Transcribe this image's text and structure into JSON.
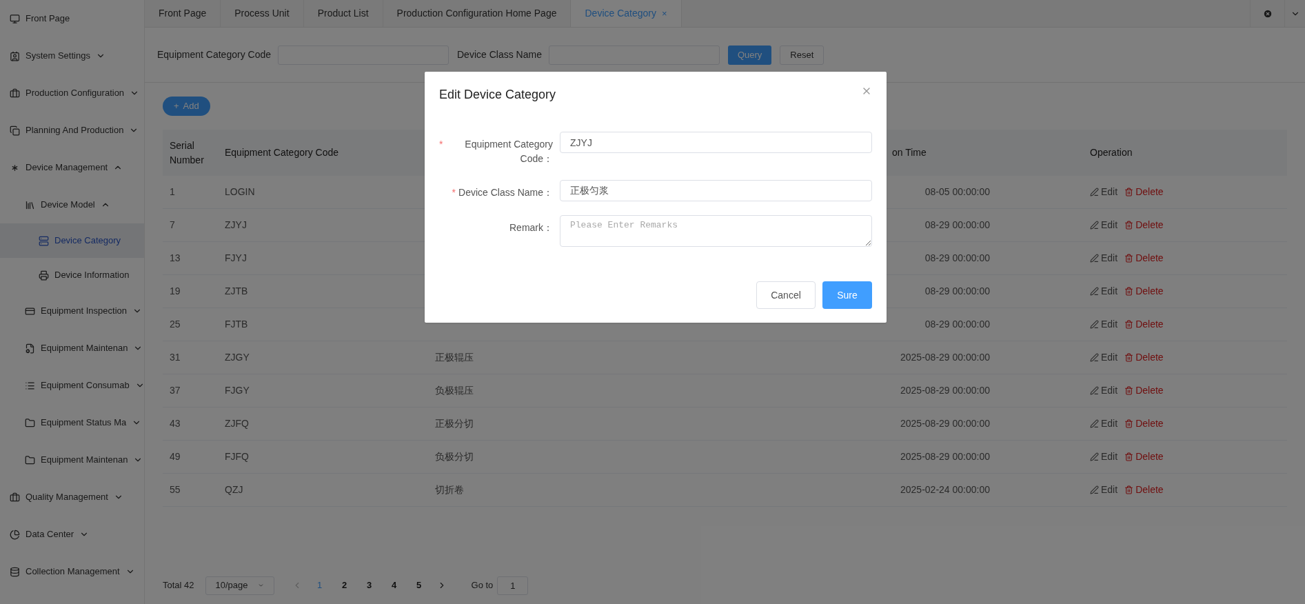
{
  "sidebar": {
    "items": [
      {
        "label": "Front Page"
      },
      {
        "label": "System Settings",
        "expanded": false
      },
      {
        "label": "Production Configuration",
        "expanded": false
      },
      {
        "label": "Planning And Production",
        "expanded": false
      },
      {
        "label": "Device Management",
        "expanded": true,
        "children": [
          {
            "label": "Device Model",
            "expanded": true,
            "children": [
              {
                "label": "Device Category",
                "selected": true
              },
              {
                "label": "Device Information",
                "selected": false
              }
            ]
          },
          {
            "label": "Equipment Inspection",
            "expanded": false
          },
          {
            "label": "Equipment Maintenan",
            "expanded": false
          },
          {
            "label": "Equipment Consumab",
            "expanded": false
          },
          {
            "label": "Equipment Status Ma",
            "expanded": false
          },
          {
            "label": "Equipment Maintenan",
            "expanded": false
          }
        ]
      },
      {
        "label": "Quality Management",
        "expanded": false
      },
      {
        "label": "Data Center",
        "expanded": false
      },
      {
        "label": "Collection Management",
        "expanded": false
      }
    ]
  },
  "tabs": [
    {
      "label": "Front Page",
      "selected": false
    },
    {
      "label": "Process Unit",
      "selected": false
    },
    {
      "label": "Product List",
      "selected": false
    },
    {
      "label": "Production Configuration Home Page",
      "selected": false
    },
    {
      "label": "Device Category",
      "selected": true,
      "close": "×"
    }
  ],
  "filters": {
    "fields": [
      {
        "label": "Equipment Category Code"
      },
      {
        "label": "Device Class Name"
      }
    ],
    "buttons": [
      {
        "label": "Query",
        "kind": "primary"
      },
      {
        "label": "Reset",
        "kind": "default"
      }
    ]
  },
  "add_button": {
    "label": "Add",
    "icon": "+"
  },
  "table": {
    "columns": [
      "Serial Number",
      "Equipment Category Code",
      null,
      "on Time",
      "Operation"
    ],
    "rows": [
      {
        "serial": "1",
        "code": "LOGIN",
        "name": null,
        "time": "08-05 00:00:00",
        "edit": "Edit",
        "delete": "Delete"
      },
      {
        "serial": "7",
        "code": "ZJYJ",
        "name": null,
        "time": "08-29 00:00:00",
        "edit": "Edit",
        "delete": "Delete"
      },
      {
        "serial": "13",
        "code": "FJYJ",
        "name": null,
        "time": "08-29 00:00:00",
        "edit": "Edit",
        "delete": "Delete"
      },
      {
        "serial": "19",
        "code": "ZJTB",
        "name": null,
        "time": "08-29 00:00:00",
        "edit": "Edit",
        "delete": "Delete"
      },
      {
        "serial": "25",
        "code": "FJTB",
        "name": null,
        "time": "08-29 00:00:00",
        "edit": "Edit",
        "delete": "Delete"
      },
      {
        "serial": "31",
        "code": "ZJGY",
        "name": "正极辊压",
        "time": "2025-08-29 00:00:00",
        "edit": "Edit",
        "delete": "Delete"
      },
      {
        "serial": "37",
        "code": "FJGY",
        "name": "负极辊压",
        "time": "2025-08-29 00:00:00",
        "edit": "Edit",
        "delete": "Delete"
      },
      {
        "serial": "43",
        "code": "ZJFQ",
        "name": "正极分切",
        "time": "2025-08-29 00:00:00",
        "edit": "Edit",
        "delete": "Delete"
      },
      {
        "serial": "49",
        "code": "FJFQ",
        "name": "负极分切",
        "time": "2025-08-29 00:00:00",
        "edit": "Edit",
        "delete": "Delete"
      },
      {
        "serial": "55",
        "code": "QZJ",
        "name": "切折卷",
        "time": "2025-02-24 00:00:00",
        "edit": "Edit",
        "delete": "Delete"
      }
    ]
  },
  "pagination": {
    "total": "Total 42",
    "page_size": "10/page",
    "pages": [
      {
        "label": "1",
        "selected": true
      },
      {
        "label": "2",
        "selected": false
      },
      {
        "label": "3",
        "selected": false
      },
      {
        "label": "4",
        "selected": false
      },
      {
        "label": "5",
        "selected": false
      }
    ],
    "goto_label": "Go to",
    "goto_value": "1"
  },
  "dialog": {
    "title": "Edit Device Category",
    "fields": [
      {
        "label": "Equipment Category Code：",
        "required_mark": "*",
        "kind": "input",
        "value": "ZJYJ"
      },
      {
        "label": "Device Class Name：",
        "required_mark": "*",
        "kind": "input",
        "value": "正极匀浆"
      },
      {
        "label": "Remark：",
        "kind": "textarea",
        "placeholder": "Please Enter Remarks"
      }
    ],
    "buttons": [
      {
        "label": "Cancel",
        "kind": "default"
      },
      {
        "label": "Sure",
        "kind": "primary"
      }
    ]
  }
}
